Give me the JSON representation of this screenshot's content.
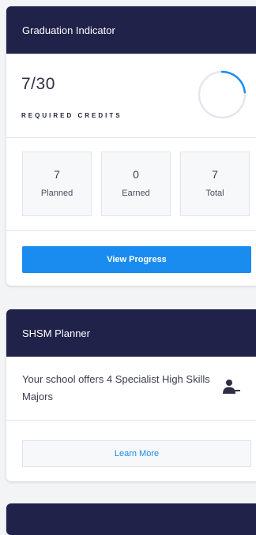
{
  "graduation": {
    "title": "Graduation Indicator",
    "credits_value": "7/30",
    "credits_label": "REQUIRED CREDITS",
    "progress_fraction": 0.233,
    "stats": [
      {
        "value": "7",
        "label": "Planned"
      },
      {
        "value": "0",
        "label": "Earned"
      },
      {
        "value": "7",
        "label": "Total"
      }
    ],
    "button_label": "View Progress"
  },
  "shsm": {
    "title": "SHSM Planner",
    "description": "Your school offers 4 Specialist High Skills Majors",
    "button_label": "Learn More"
  },
  "colors": {
    "header_bg": "#21224a",
    "accent": "#1a8cf0",
    "ring_track": "#e3e7ee"
  }
}
